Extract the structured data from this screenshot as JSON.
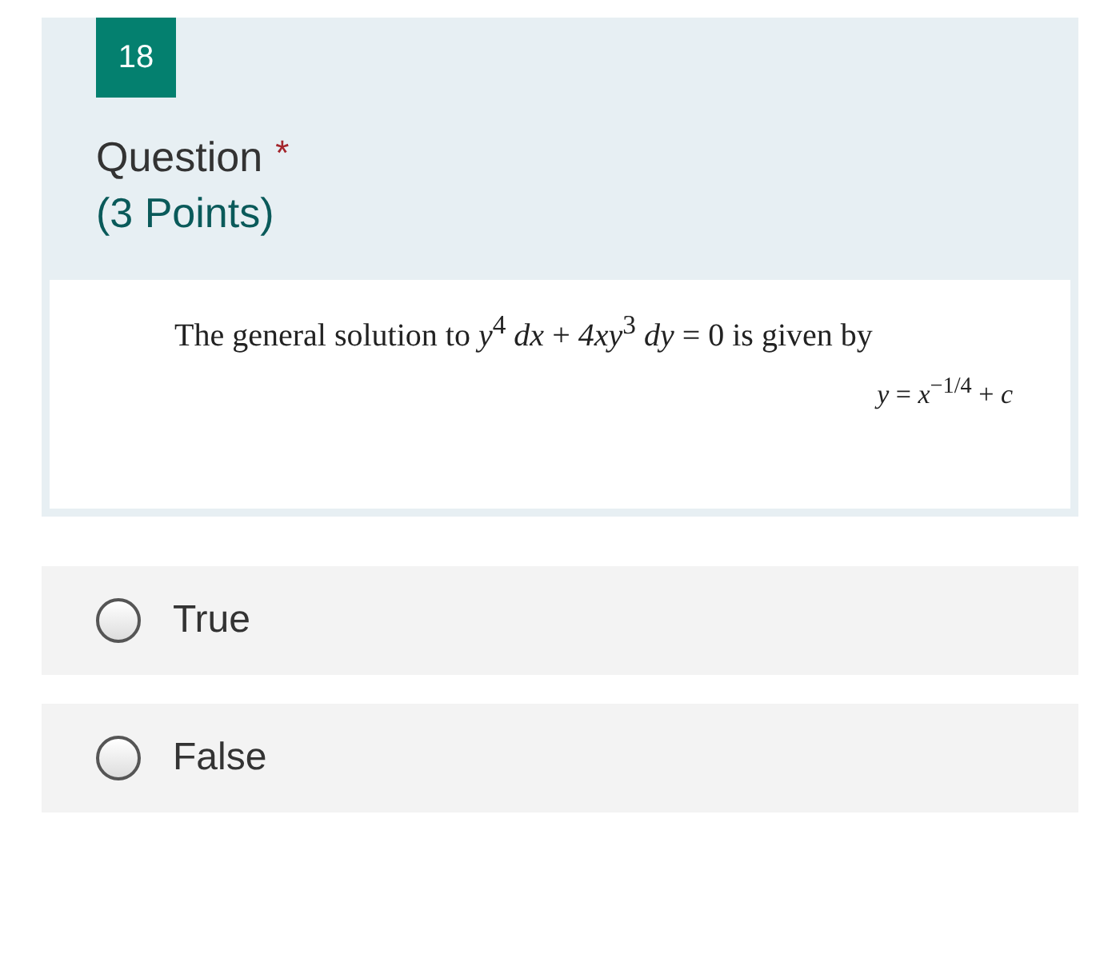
{
  "question": {
    "number": "18",
    "title": "Question",
    "required_mark": "*",
    "points": "(3 Points)",
    "image_lines": [
      "The general solution to *y*$^{4}$ *dx* + *4xy*$^{3}$ *dy* = 0 is given by",
      "*y* = *x*$^{−1/4}$ + *c*"
    ]
  },
  "options": [
    {
      "label": "True",
      "selected": false
    },
    {
      "label": "False",
      "selected": false
    }
  ]
}
